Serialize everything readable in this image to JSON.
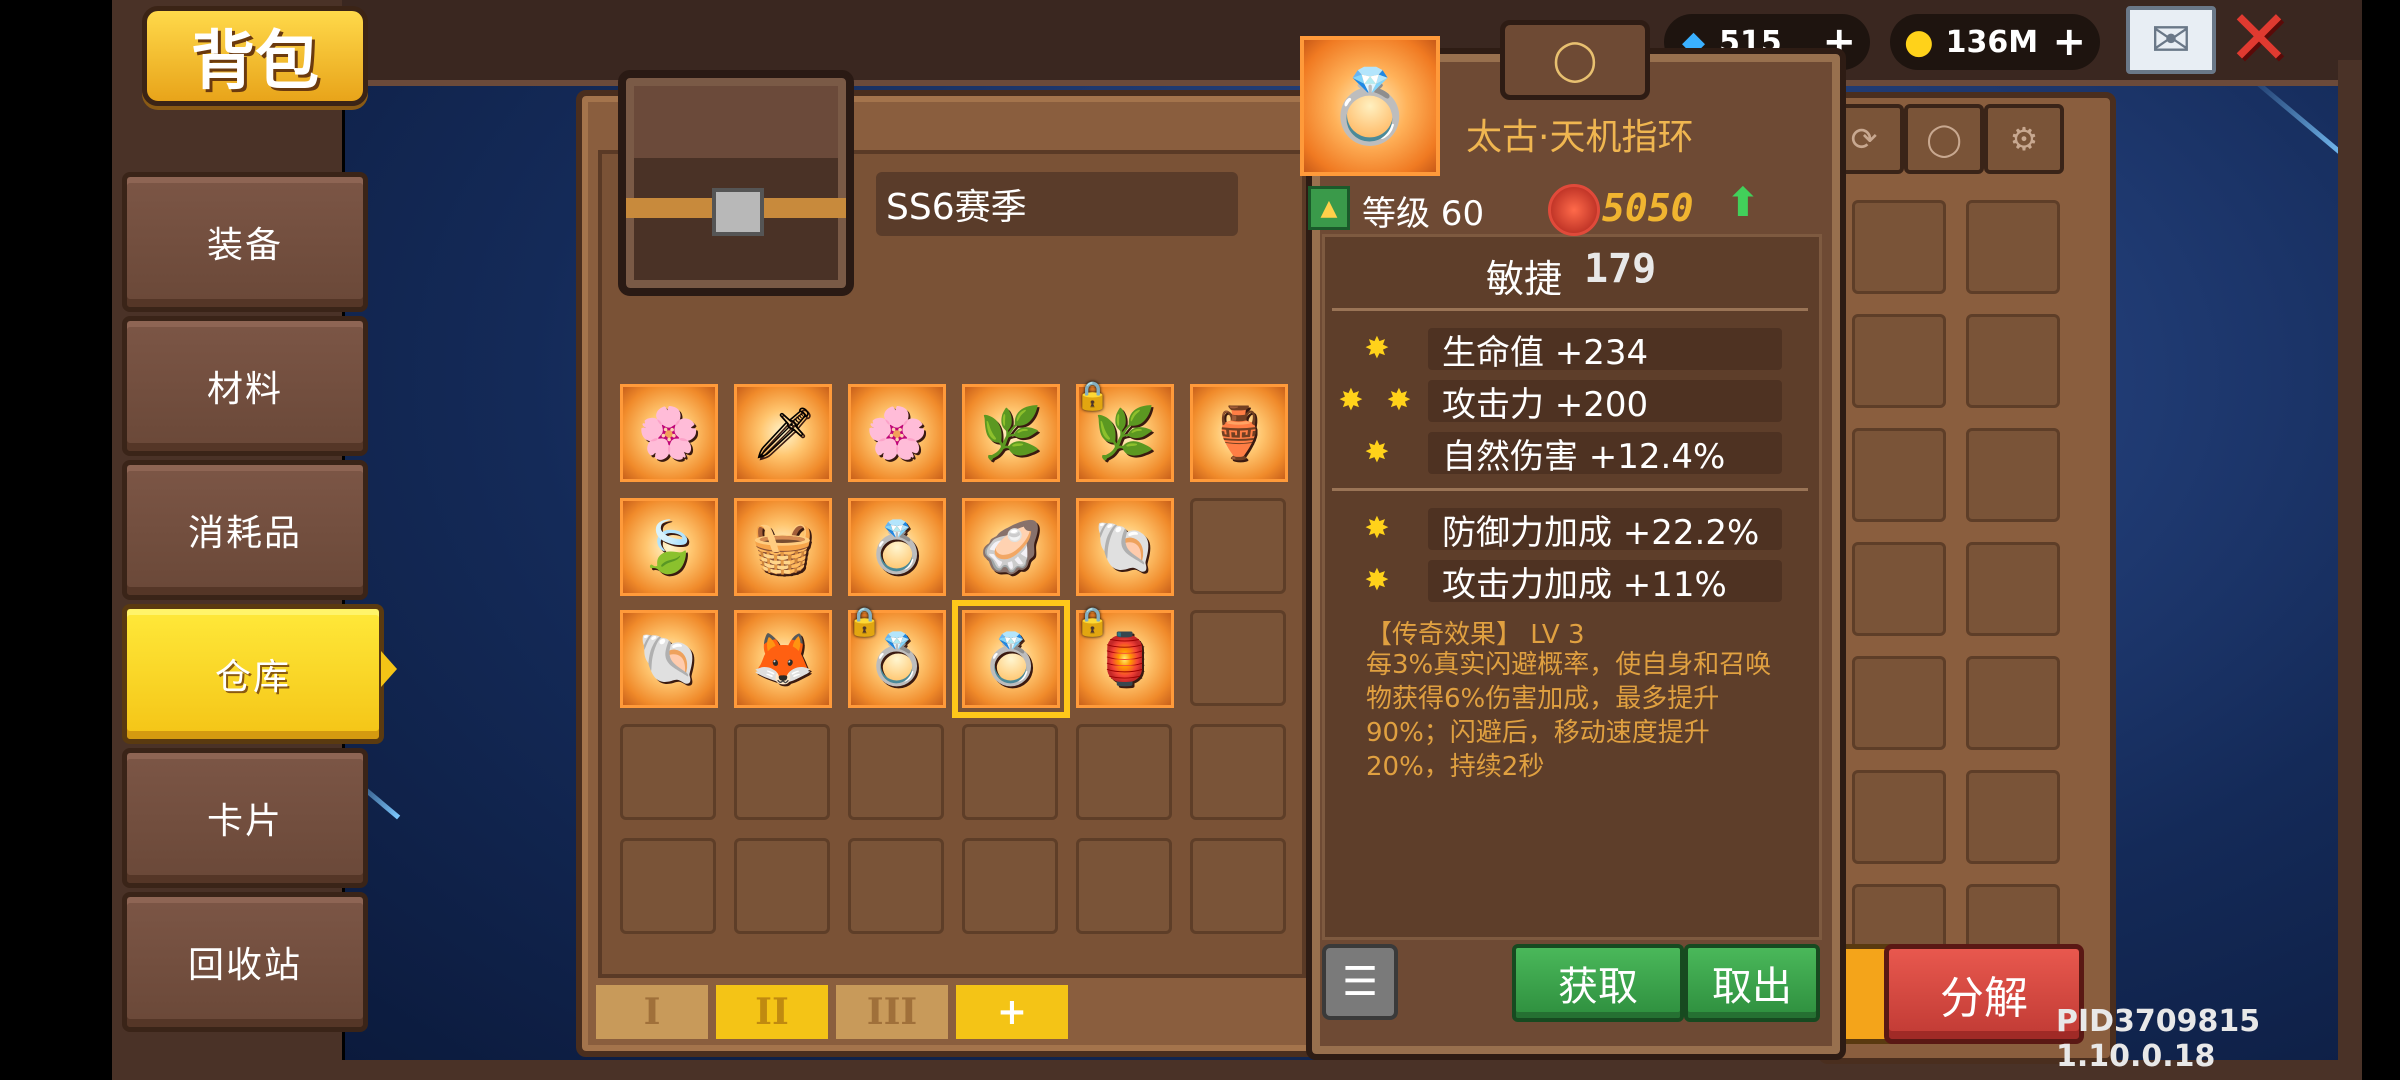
{
  "title": "背包",
  "side_tabs": [
    "装备",
    "材料",
    "消耗品",
    "仓库",
    "卡片",
    "回收站"
  ],
  "active_tab": "仓库",
  "storage": {
    "season_label": "SS6赛季",
    "bottom_tabs": [
      "I",
      "II",
      "III",
      "+"
    ],
    "items": [
      [
        "🌸",
        "🗡",
        "🌸",
        "🌿",
        "🌿",
        "🏺"
      ],
      [
        "🍃",
        "🧺",
        "💍",
        "🦪",
        "🐚",
        ""
      ],
      [
        "🐚",
        "🦊",
        "💍",
        "💍",
        "🏮",
        ""
      ]
    ]
  },
  "currency": {
    "gems": "515",
    "gold": "136M"
  },
  "detail": {
    "name": "太古·天机指环",
    "level_label": "等级 60",
    "power": "5050",
    "main_stat_label": "敏捷",
    "main_stat_value": "179",
    "stats_a": [
      "生命值 +234",
      "攻击力 +200",
      "自然伤害 +12.4%"
    ],
    "stats_b": [
      "防御力加成 +22.2%",
      "攻击力加成 +11%"
    ],
    "legend_title": "【传奇效果】 LV 3",
    "legend_desc": "每3%真实闪避概率，使自身和召唤物获得6%伤害加成，最多提升90%；闪避后，移动速度提升20%，持续2秒",
    "btn_obtain": "获取",
    "btn_takeout": "取出"
  },
  "decompose_label": "分解",
  "version": "PID3709815 1.10.0.18",
  "colors": {
    "accent_gold": "#f4c416",
    "button_green": "#3ea24e",
    "button_red": "#d44a42",
    "legend_orange": "#e0a040"
  }
}
